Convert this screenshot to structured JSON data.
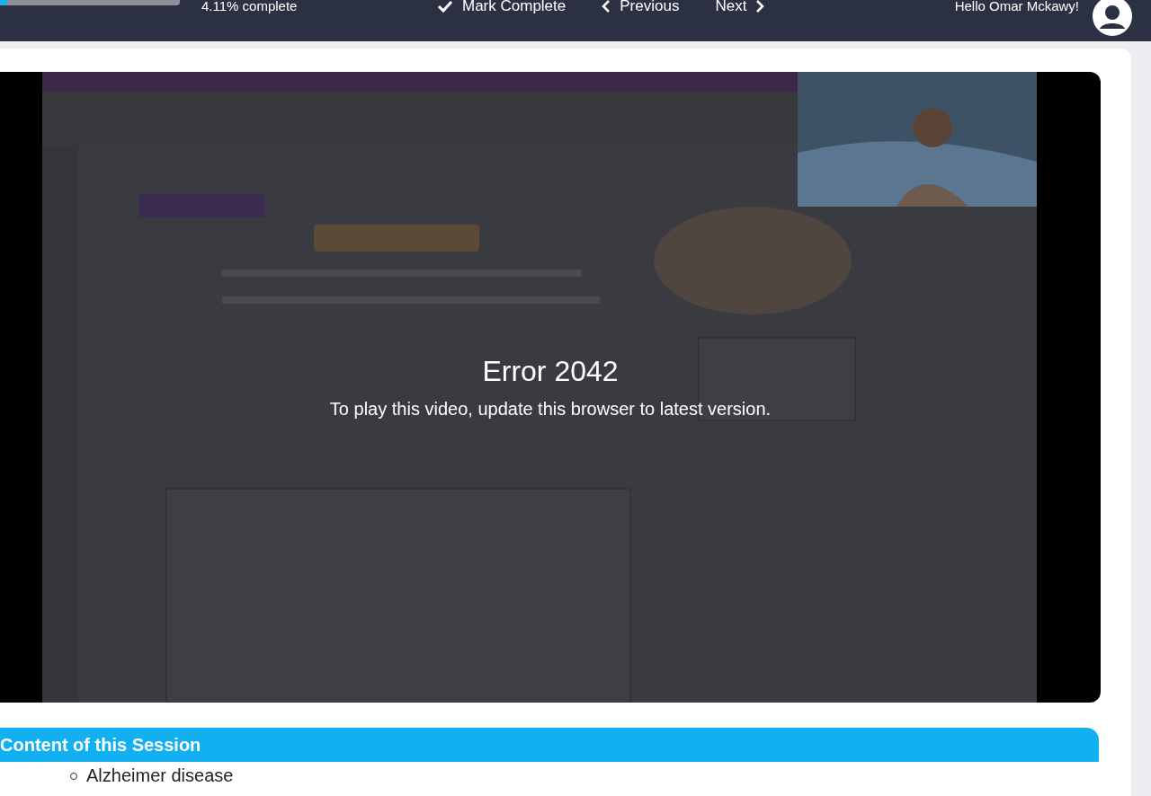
{
  "top_bar": {
    "progress": {
      "level": 0.0411,
      "label": "4.11% complete"
    },
    "buttons": [
      {
        "kind": "check",
        "label": "Mark Complete"
      },
      {
        "kind": "prev",
        "label": "Previous"
      },
      {
        "kind": "next",
        "label": "Next"
      }
    ],
    "greeting": "Hello Omar Mckawy!"
  },
  "video": {
    "kind": "picture",
    "error_title": "Error 2042",
    "error_message": "To play this video, update this browser to latest version."
  },
  "session": {
    "title": "Content of this Session",
    "items": [
      "Alzheimer disease"
    ]
  }
}
